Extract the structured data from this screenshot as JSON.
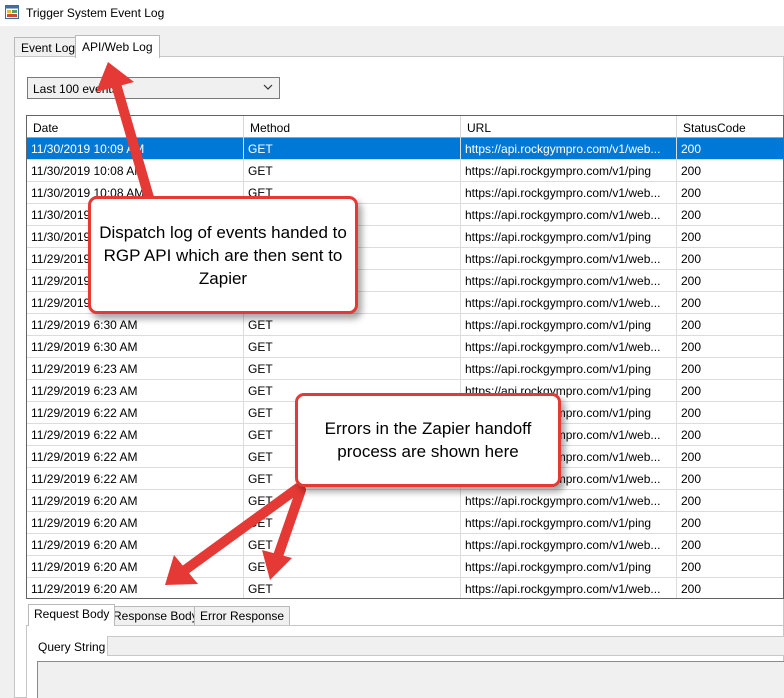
{
  "window": {
    "title": "Trigger System Event Log"
  },
  "tabs": [
    {
      "label": "Event Log"
    },
    {
      "label": "API/Web Log"
    }
  ],
  "filter": {
    "selected": "Last 100 events"
  },
  "grid": {
    "columns": [
      "Date",
      "Method",
      "URL",
      "StatusCode"
    ],
    "rows": [
      [
        "11/30/2019 10:09 AM",
        "GET",
        "https://api.rockgympro.com/v1/web...",
        "200"
      ],
      [
        "11/30/2019 10:08 AM",
        "GET",
        "https://api.rockgympro.com/v1/ping",
        "200"
      ],
      [
        "11/30/2019 10:08 AM",
        "GET",
        "https://api.rockgympro.com/v1/web...",
        "200"
      ],
      [
        "11/30/2019",
        "",
        "https://api.rockgympro.com/v1/web...",
        "200"
      ],
      [
        "11/30/2019",
        "",
        "https://api.rockgympro.com/v1/ping",
        "200"
      ],
      [
        "11/29/2019",
        "",
        "https://api.rockgympro.com/v1/web...",
        "200"
      ],
      [
        "11/29/2019",
        "",
        "https://api.rockgympro.com/v1/web...",
        "200"
      ],
      [
        "11/29/2019",
        "",
        "https://api.rockgympro.com/v1/web...",
        "200"
      ],
      [
        "11/29/2019 6:30 AM",
        "GET",
        "https://api.rockgympro.com/v1/ping",
        "200"
      ],
      [
        "11/29/2019 6:30 AM",
        "GET",
        "https://api.rockgympro.com/v1/web...",
        "200"
      ],
      [
        "11/29/2019 6:23 AM",
        "GET",
        "https://api.rockgympro.com/v1/ping",
        "200"
      ],
      [
        "11/29/2019 6:23 AM",
        "GET",
        "https://api.rockgympro.com/v1/ping",
        "200"
      ],
      [
        "11/29/2019 6:22 AM",
        "GET",
        "https://api.rockgympro.com/v1/ping",
        "200"
      ],
      [
        "11/29/2019 6:22 AM",
        "GET",
        "https://api.rockgympro.com/v1/web...",
        "200"
      ],
      [
        "11/29/2019 6:22 AM",
        "GET",
        "https://api.rockgympro.com/v1/web...",
        "200"
      ],
      [
        "11/29/2019 6:22 AM",
        "GET",
        "https://api.rockgympro.com/v1/web...",
        "200"
      ],
      [
        "11/29/2019 6:20 AM",
        "GET",
        "https://api.rockgympro.com/v1/web...",
        "200"
      ],
      [
        "11/29/2019 6:20 AM",
        "GET",
        "https://api.rockgympro.com/v1/ping",
        "200"
      ],
      [
        "11/29/2019 6:20 AM",
        "GET",
        "https://api.rockgympro.com/v1/web...",
        "200"
      ],
      [
        "11/29/2019 6:20 AM",
        "GET",
        "https://api.rockgympro.com/v1/ping",
        "200"
      ],
      [
        "11/29/2019 6:20 AM",
        "GET",
        "https://api.rockgympro.com/v1/web...",
        "200"
      ]
    ]
  },
  "detail_tabs": [
    {
      "label": "Request Body"
    },
    {
      "label": "Response Body"
    },
    {
      "label": "Error Response"
    }
  ],
  "query_string": {
    "label": "Query String",
    "value": ""
  },
  "annotations": {
    "dispatch_log": "Dispatch log of events handed to RGP API which are then sent to Zapier",
    "errors": "Errors in the Zapier handoff process are shown here"
  },
  "colors": {
    "selection": "#0078d7",
    "annotation": "#e53935"
  }
}
